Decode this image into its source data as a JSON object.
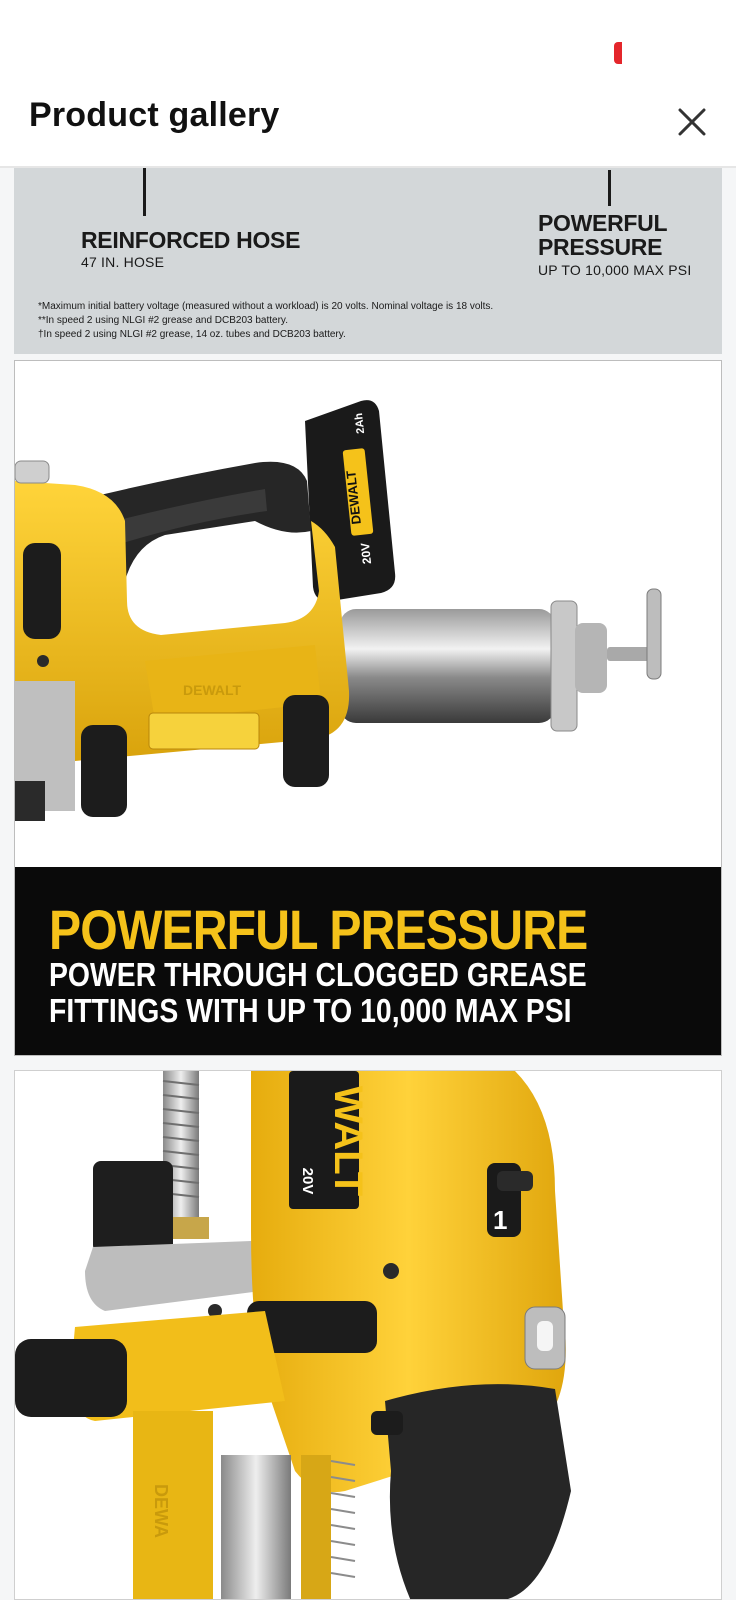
{
  "header": {
    "title": "Product gallery",
    "close_label": "close"
  },
  "gallery": {
    "image1": {
      "left_callout": {
        "heading": "REINFORCED HOSE",
        "sub": "47 IN. HOSE"
      },
      "right_callout": {
        "heading_line1": "POWERFUL",
        "heading_line2": "PRESSURE",
        "sub": "UP TO 10,000 MAX PSI"
      },
      "footnotes": [
        "*Maximum initial battery voltage (measured without a workload) is 20 volts. Nominal voltage is 18 volts.",
        "**In speed 2 using NLGI #2 grease and DCB203 battery.",
        "†In speed 2 using NLGI #2 grease, 14 oz. tubes and DCB203 battery."
      ]
    },
    "image2": {
      "caption_title": "POWERFUL PRESSURE",
      "caption_body_line1": "POWER THROUGH CLOGGED GREASE",
      "caption_body_line2": "FITTINGS WITH UP TO 10,000 MAX PSI",
      "brand_text": "DEWALT",
      "battery_brand": "DEWALT",
      "battery_voltage": "20V",
      "battery_capacity": "2Ah"
    },
    "image3": {
      "brand_text": "WALT",
      "voltage": "20V",
      "switch_label": "1",
      "side_brand": "DEWA"
    }
  },
  "colors": {
    "accent": "#f5c21a",
    "tool_yellow": "#f2c11a",
    "band": "#0a0a0a",
    "spec_panel": "#d3d7d9",
    "status_red": "#e4262b"
  },
  "icons": [
    "close-icon",
    "status-dot"
  ]
}
